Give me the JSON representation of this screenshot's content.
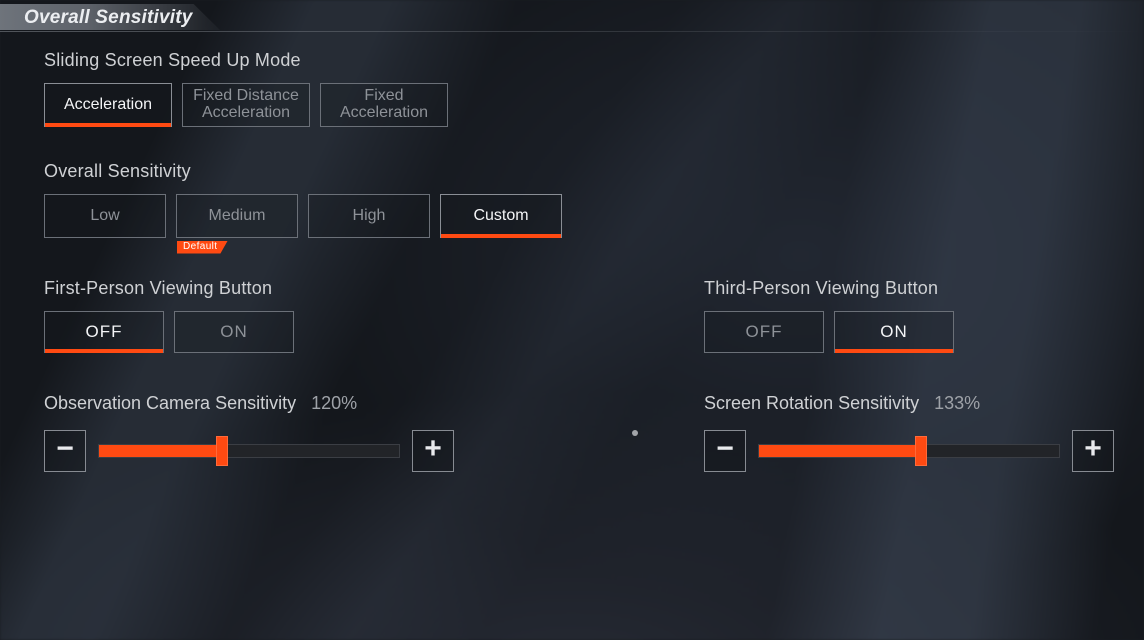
{
  "header": {
    "title": "Overall Sensitivity"
  },
  "sliding_mode": {
    "label": "Sliding Screen Speed Up Mode",
    "options": [
      {
        "label": "Acceleration",
        "selected": true
      },
      {
        "label": "Fixed Distance Acceleration",
        "selected": false,
        "multiline": true
      },
      {
        "label": "Fixed Acceleration",
        "selected": false,
        "multiline": true
      }
    ]
  },
  "overall_sensitivity": {
    "label": "Overall Sensitivity",
    "options": [
      {
        "label": "Low",
        "selected": false
      },
      {
        "label": "Medium",
        "selected": false,
        "default_tag": "Default"
      },
      {
        "label": "High",
        "selected": false
      },
      {
        "label": "Custom",
        "selected": true
      }
    ]
  },
  "first_person_view": {
    "label": "First-Person Viewing Button",
    "off": "OFF",
    "on": "ON",
    "value": "OFF"
  },
  "third_person_view": {
    "label": "Third-Person Viewing Button",
    "off": "OFF",
    "on": "ON",
    "value": "ON"
  },
  "observation_camera": {
    "label": "Observation Camera Sensitivity",
    "value_text": "120%",
    "percent": 41
  },
  "screen_rotation": {
    "label": "Screen Rotation Sensitivity",
    "value_text": "133%",
    "percent": 54
  },
  "colors": {
    "accent": "#ff4a12"
  }
}
